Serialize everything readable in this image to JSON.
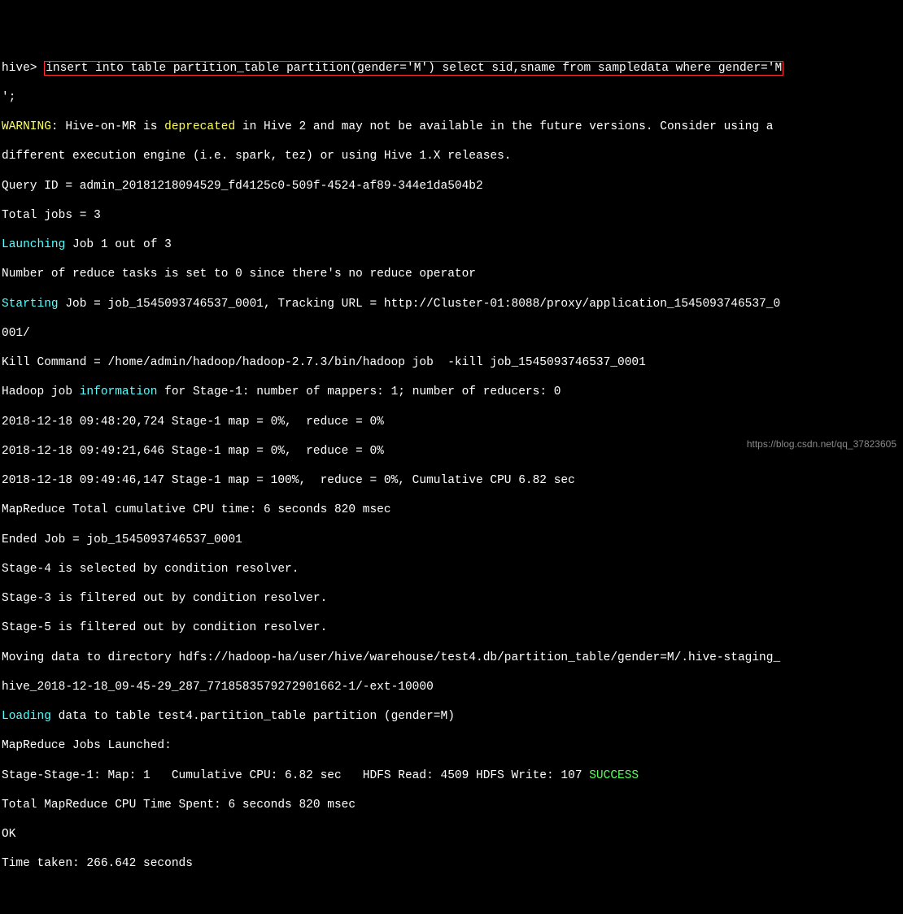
{
  "prompt": "hive> ",
  "command_part1": "insert into table partition_table partition(gender='M') select sid,sname from sampledata where gender='M",
  "command_part2": "';",
  "warn_label": "WARNING",
  "warn_seg1": ": Hive-on-MR is ",
  "warn_deprecated": "deprecated",
  "warn_seg2": " in Hive 2 and may not be available in the future versions. Consider using a",
  "warn_line2": "different execution engine (i.e. spark, tez) or using Hive 1.X releases.",
  "query_id": "Query ID = admin_20181218094529_fd4125c0-509f-4524-af89-344e1da504b2",
  "total_jobs": "Total jobs = 3",
  "launching": "Launching",
  "launching_rest": " Job 1 out of 3",
  "reduce_tasks": "Number of reduce tasks is set to 0 since there's no reduce operator",
  "starting": "Starting",
  "starting_rest": " Job = job_1545093746537_0001, Tracking URL = http://Cluster-01:8088/proxy/application_1545093746537_0",
  "starting_wrap": "001/",
  "kill_cmd": "Kill Command = /home/admin/hadoop/hadoop-2.7.3/bin/hadoop job  -kill job_1545093746537_0001",
  "hadoop_job_pre": "Hadoop job ",
  "information": "information",
  "hadoop_job_post": " for Stage-1: number of mappers: 1; number of reducers: 0",
  "ts1": "2018-12-18 09:48:20,724 Stage-1 map = 0%,  reduce = 0%",
  "ts2": "2018-12-18 09:49:21,646 Stage-1 map = 0%,  reduce = 0%",
  "ts3": "2018-12-18 09:49:46,147 Stage-1 map = 100%,  reduce = 0%, Cumulative CPU 6.82 sec",
  "mr_total": "MapReduce Total cumulative CPU time: 6 seconds 820 msec",
  "ended": "Ended Job = job_1545093746537_0001",
  "stage4": "Stage-4 is selected by condition resolver.",
  "stage3": "Stage-3 is filtered out by condition resolver.",
  "stage5": "Stage-5 is filtered out by condition resolver.",
  "moving": "Moving data to directory hdfs://hadoop-ha/user/hive/warehouse/test4.db/partition_table/gender=M/.hive-staging_",
  "moving_wrap": "hive_2018-12-18_09-45-29_287_7718583579272901662-1/-ext-10000",
  "loading": "Loading",
  "loading_rest": " data to table test4.partition_table partition (gender=M)",
  "mr_launched": "MapReduce Jobs Launched:",
  "stage_stage": "Stage-Stage-1: Map: 1   Cumulative CPU: 6.82 sec   HDFS Read: 4509 HDFS Write: 107 ",
  "success": "SUCCESS",
  "total_mr_cpu": "Total MapReduce CPU Time Spent: 6 seconds 820 msec",
  "ok": "OK",
  "time_taken": "Time taken: 266.642 seconds",
  "watermark": "https://blog.csdn.net/qq_37823605"
}
